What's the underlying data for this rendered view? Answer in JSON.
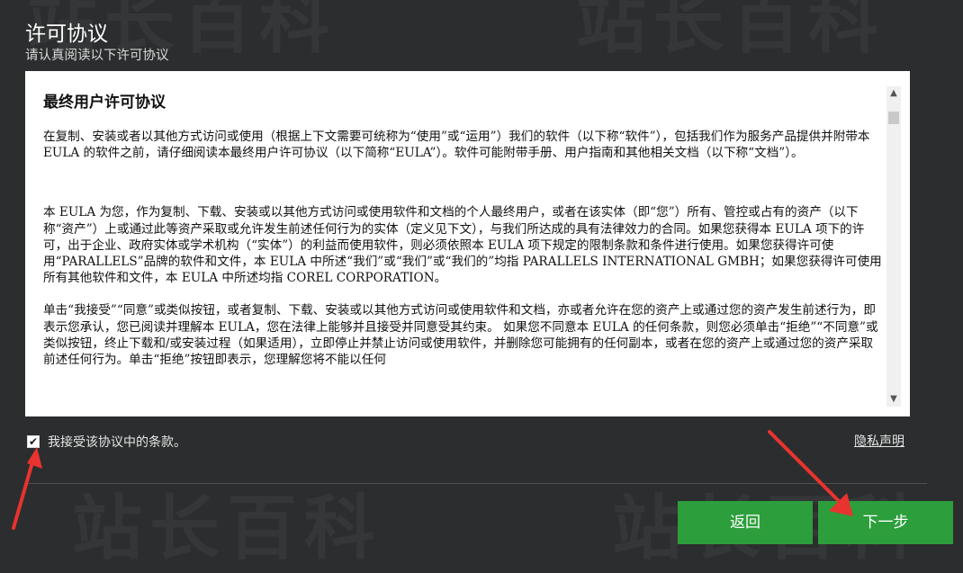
{
  "header": {
    "title": "许可协议",
    "subtitle": "请认真阅读以下许可协议"
  },
  "agreement": {
    "heading": "最终用户许可协议",
    "paragraphs": [
      "在复制、安装或者以其他方式访问或使用（根据上下文需要可统称为“使用”或“运用”）我们的软件（以下称“软件”），包括我们作为服务产品提供并附带本 EULA 的软件之前，请仔细阅读本最终用户许可协议（以下简称“EULA”）。软件可能附带手册、用户指南和其他相关文档（以下称“文档”）。",
      "本 EULA 为您，作为复制、下载、安装或以其他方式访问或使用软件和文档的个人最终用户，或者在该实体（即“您”）所有、管控或占有的资产（以下称“资产”）上或通过此等资产采取或允许发生前述任何行为的实体（定义见下文），与我们所达成的具有法律效力的合同。如果您获得本 EULA 项下的许可，出于企业、政府实体或学术机构（“实体”）的利益而使用软件，则必须依照本 EULA 项下规定的限制条款和条件进行使用。如果您获得许可使用“PARALLELS”品牌的软件和文件，本 EULA 中所述“我们”或“我们”或“我们的”均指 PARALLELS INTERNATIONAL GMBH；如果您获得许可使用所有其他软件和文件，本 EULA 中所述均指 COREL CORPORATION。",
      "单击“我接受”“同意”或类似按钮，或者复制、下载、安装或以其他方式访问或使用软件和文档，亦或者允许在您的资产上或通过您的资产发生前述行为，即表示您承认，您已阅读并理解本 EULA，您在法律上能够并且接受并同意受其约束。 如果您不同意本 EULA 的任何条款，则您必须单击“拒绝”“不同意”或类似按钮，终止下载和/或安装过程（如果适用），立即停止并禁止访问或使用软件，并删除您可能拥有的任何副本，或者在您的资产上或通过您的资产采取前述任何行为。单击“拒绝”按钮即表示，您理解您将不能以任何"
    ]
  },
  "accept_checkbox": {
    "label": "我接受该协议中的条款。",
    "checked": true
  },
  "privacy_link": "隐私声明",
  "buttons": {
    "back": "返回",
    "next": "下一步"
  },
  "watermark": "站长百科",
  "colors": {
    "background": "#2c2d2e",
    "button": "#2c9e3c",
    "arrow": "#e8332f"
  }
}
